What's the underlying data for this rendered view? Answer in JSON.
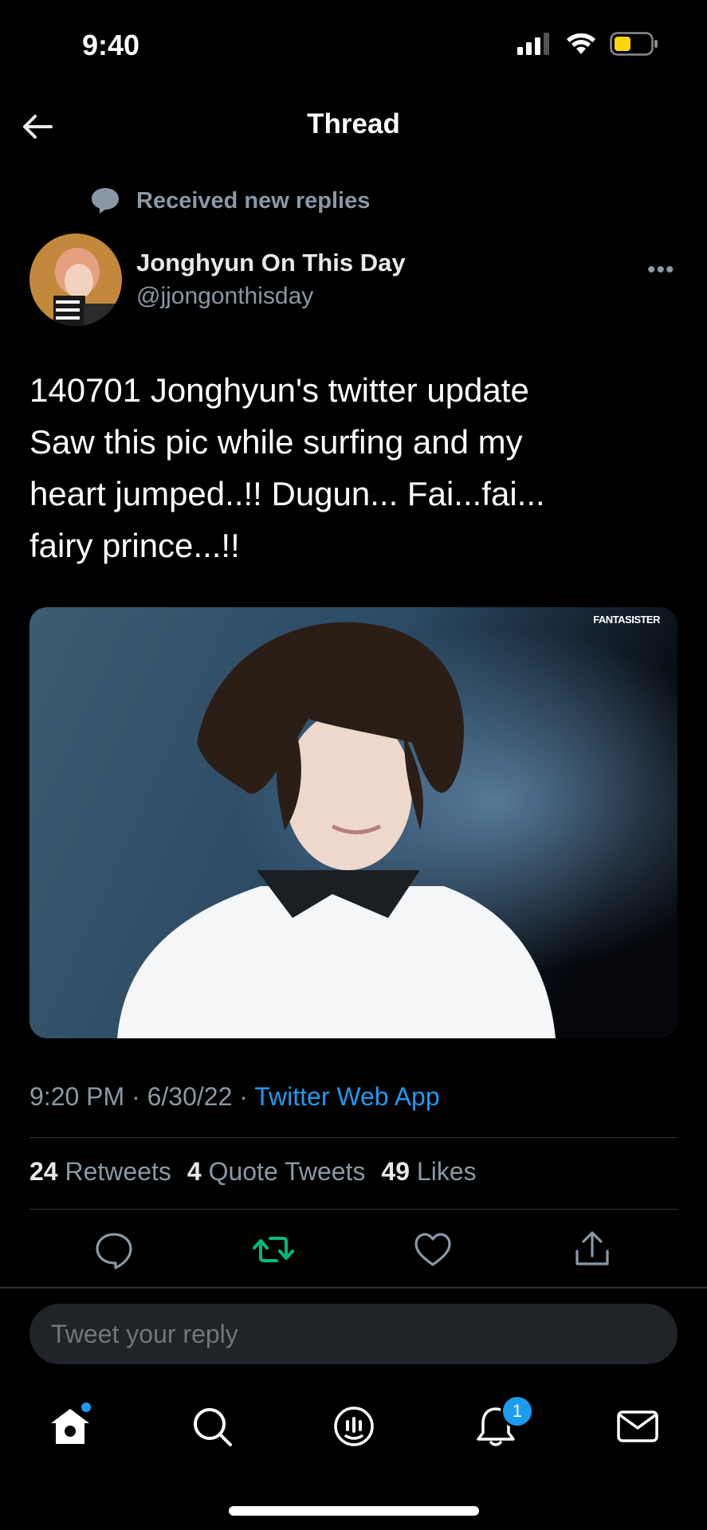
{
  "status_bar": {
    "time": "9:40"
  },
  "nav": {
    "title": "Thread"
  },
  "notice": {
    "text": "Received new replies"
  },
  "tweet": {
    "author_name": "Jonghyun On This Day",
    "author_handle": "@jjongonthisday",
    "text": "140701 Jonghyun's twitter update\nSaw this pic while surfing and my\nheart jumped..!! Dugun... Fai...fai...\nfairy prince...!!",
    "media_watermark": "FANTASISTER",
    "time": "9:20 PM",
    "date": "6/30/22",
    "source": "Twitter Web App",
    "separator": "·"
  },
  "stats": {
    "retweets_count": "24",
    "retweets_label": "Retweets",
    "quotes_count": "4",
    "quotes_label": "Quote Tweets",
    "likes_count": "49",
    "likes_label": "Likes"
  },
  "reply": {
    "placeholder": "Tweet your reply"
  },
  "tabbar": {
    "notifications_badge": "1"
  },
  "colors": {
    "accent": "#1d9bf0",
    "retweet_active": "#00ba7c",
    "background": "#000000",
    "muted": "#8b98a5"
  }
}
